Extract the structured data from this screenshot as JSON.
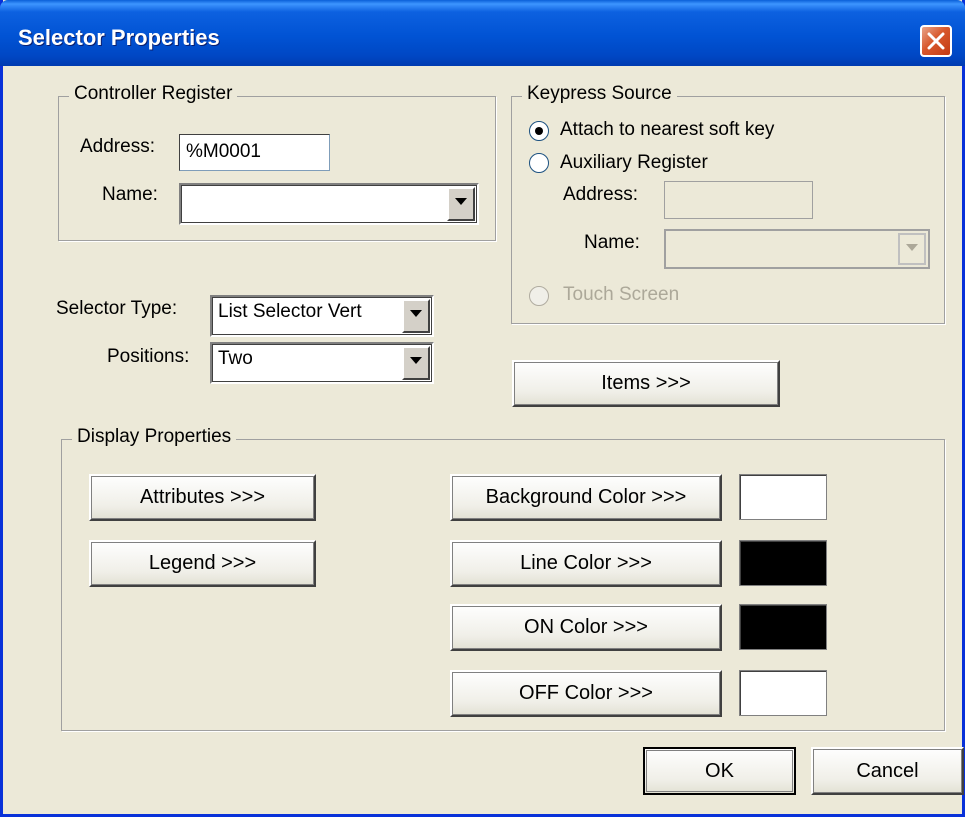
{
  "window": {
    "title": "Selector Properties"
  },
  "controller_register": {
    "group_label": "Controller Register",
    "address_label": "Address:",
    "address_value": "%M0001",
    "name_label": "Name:",
    "name_value": ""
  },
  "keypress_source": {
    "group_label": "Keypress Source",
    "option_attach": "Attach to nearest soft key",
    "option_aux": "Auxiliary Register",
    "address_label": "Address:",
    "address_value": "",
    "name_label": "Name:",
    "name_value": "",
    "option_touch": "Touch Screen",
    "selected": "Attach to nearest soft key"
  },
  "selector": {
    "type_label": "Selector Type:",
    "type_value": "List Selector Vert",
    "positions_label": "Positions:",
    "positions_value": "Two",
    "items_button": "Items >>>"
  },
  "display_properties": {
    "group_label": "Display Properties",
    "attributes_button": "Attributes >>>",
    "legend_button": "Legend >>>",
    "background_color_button": "Background Color >>>",
    "line_color_button": "Line Color >>>",
    "on_color_button": "ON Color >>>",
    "off_color_button": "OFF Color >>>",
    "background_color": "#ffffff",
    "line_color": "#000000",
    "on_color": "#000000",
    "off_color": "#ffffff"
  },
  "footer": {
    "ok": "OK",
    "cancel": "Cancel"
  },
  "icons": {
    "close": "close-icon",
    "dropdown": "chevron-down-icon"
  }
}
